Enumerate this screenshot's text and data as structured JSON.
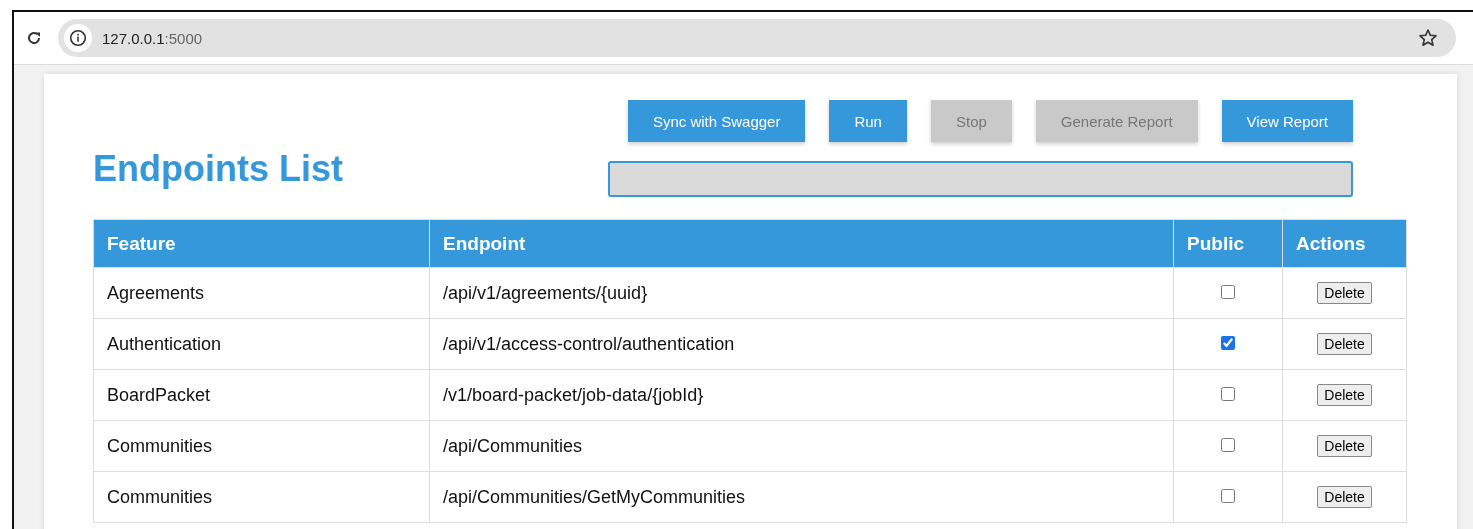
{
  "browser": {
    "url_host": "127.0.0.1",
    "url_port": ":5000"
  },
  "page": {
    "title": "Endpoints List",
    "buttons": [
      {
        "label": "Sync with Swagger",
        "disabled": false
      },
      {
        "label": "Run",
        "disabled": false
      },
      {
        "label": "Stop",
        "disabled": true
      },
      {
        "label": "Generate Report",
        "disabled": true
      },
      {
        "label": "View Report",
        "disabled": false
      }
    ],
    "progress": {
      "level": 0
    },
    "table": {
      "columns": [
        "Feature",
        "Endpoint",
        "Public",
        "Actions"
      ],
      "rows": [
        {
          "feature": "Agreements",
          "endpoint": "/api/v1/agreements/{uuid}",
          "public": false,
          "action": "Delete"
        },
        {
          "feature": "Authentication",
          "endpoint": "/api/v1/access-control/authentication",
          "public": true,
          "action": "Delete"
        },
        {
          "feature": "BoardPacket",
          "endpoint": "/v1/board-packet/job-data/{jobId}",
          "public": false,
          "action": "Delete"
        },
        {
          "feature": "Communities",
          "endpoint": "/api/Communities",
          "public": false,
          "action": "Delete"
        },
        {
          "feature": "Communities",
          "endpoint": "/api/Communities/GetMyCommunities",
          "public": false,
          "action": "Delete"
        }
      ]
    }
  }
}
